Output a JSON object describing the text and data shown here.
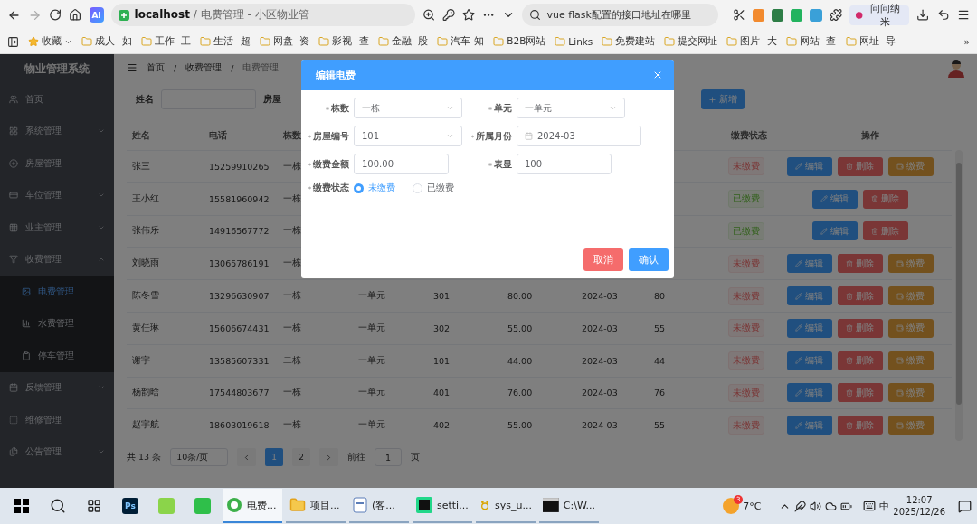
{
  "browser": {
    "ai_badge": "AI",
    "url_host": "localhost",
    "url_title": "/ 电费管理 - 小区物业管",
    "search": "vue flask配置的接口地址在哪里",
    "profile_button": "问问纳米",
    "bookmarks_label": "收藏",
    "bookmarks": [
      "成人--如",
      "工作--工",
      "生活--超",
      "网盘--资",
      "影视--查",
      "金融--股",
      "汽车-知",
      "B2B网站",
      "Links",
      "免费建站",
      "提交网址",
      "图片--大",
      "网站--查",
      "网址--导"
    ],
    "more": "»"
  },
  "sidebar": {
    "title": "物业管理系统",
    "items": [
      {
        "label": "首页",
        "kind": "link"
      },
      {
        "label": "系统管理",
        "kind": "group",
        "expanded": false
      },
      {
        "label": "房屋管理",
        "kind": "link"
      },
      {
        "label": "车位管理",
        "kind": "group",
        "expanded": false
      },
      {
        "label": "业主管理",
        "kind": "group",
        "expanded": false
      },
      {
        "label": "收费管理",
        "kind": "group",
        "expanded": true,
        "children": [
          {
            "label": "电费管理",
            "selected": true
          },
          {
            "label": "水费管理",
            "selected": false
          },
          {
            "label": "停车管理",
            "selected": false
          }
        ]
      },
      {
        "label": "反馈管理",
        "kind": "group",
        "expanded": false
      },
      {
        "label": "维修管理",
        "kind": "link"
      },
      {
        "label": "公告管理",
        "kind": "group",
        "expanded": false
      }
    ]
  },
  "header": {
    "breadcrumb": [
      "首页",
      "收费管理",
      "电费管理"
    ],
    "separator": "/"
  },
  "search": {
    "fields": [
      {
        "label": "姓名"
      },
      {
        "label": "房屋"
      }
    ],
    "add_button": "新增"
  },
  "table": {
    "columns": {
      "name": "姓名",
      "phone": "电话",
      "building": "栋数",
      "status": "缴费状态",
      "actions": "操作"
    },
    "rows": [
      {
        "name": "张三",
        "phone": "15259910265",
        "building": "一栋",
        "status": "未缴费",
        "paid": false,
        "actions": [
          {
            "kind": "edit",
            "label": "编辑"
          },
          {
            "kind": "delete",
            "label": "删除"
          },
          {
            "kind": "pay",
            "label": "缴费"
          }
        ]
      },
      {
        "name": "王小红",
        "phone": "15581960942",
        "building": "一栋",
        "status": "已缴费",
        "paid": true,
        "actions": [
          {
            "kind": "edit",
            "label": "编辑"
          },
          {
            "kind": "delete",
            "label": "删除"
          }
        ]
      },
      {
        "name": "张伟乐",
        "phone": "14916567772",
        "building": "一栋",
        "status": "已缴费",
        "paid": true,
        "actions": [
          {
            "kind": "edit",
            "label": "编辑"
          },
          {
            "kind": "delete",
            "label": "删除"
          }
        ]
      },
      {
        "name": "刘晓雨",
        "phone": "13065786191",
        "building": "一栋",
        "status": "未缴费",
        "paid": false,
        "actions": [
          {
            "kind": "edit",
            "label": "编辑"
          },
          {
            "kind": "delete",
            "label": "删除"
          },
          {
            "kind": "pay",
            "label": "缴费"
          }
        ]
      },
      {
        "name": "陈冬雪",
        "phone": "13296630907",
        "building": "一栋",
        "unit": "一单元",
        "room": "301",
        "amount": "80.00",
        "month": "2024-03",
        "reading": "80",
        "status": "未缴费",
        "paid": false,
        "actions": [
          {
            "kind": "edit",
            "label": "编辑"
          },
          {
            "kind": "delete",
            "label": "删除"
          },
          {
            "kind": "pay",
            "label": "缴费"
          }
        ]
      },
      {
        "name": "黄任琳",
        "phone": "15606674431",
        "building": "一栋",
        "unit": "一单元",
        "room": "302",
        "amount": "55.00",
        "month": "2024-03",
        "reading": "55",
        "status": "未缴费",
        "paid": false,
        "actions": [
          {
            "kind": "edit",
            "label": "编辑"
          },
          {
            "kind": "delete",
            "label": "删除"
          },
          {
            "kind": "pay",
            "label": "缴费"
          }
        ]
      },
      {
        "name": "谢宇",
        "phone": "13585607331",
        "building": "二栋",
        "unit": "一单元",
        "room": "101",
        "amount": "44.00",
        "month": "2024-03",
        "reading": "44",
        "status": "未缴费",
        "paid": false,
        "actions": [
          {
            "kind": "edit",
            "label": "编辑"
          },
          {
            "kind": "delete",
            "label": "删除"
          },
          {
            "kind": "pay",
            "label": "缴费"
          }
        ]
      },
      {
        "name": "杨韵晗",
        "phone": "17544803677",
        "building": "一栋",
        "unit": "一单元",
        "room": "401",
        "amount": "76.00",
        "month": "2024-03",
        "reading": "76",
        "status": "未缴费",
        "paid": false,
        "actions": [
          {
            "kind": "edit",
            "label": "编辑"
          },
          {
            "kind": "delete",
            "label": "删除"
          },
          {
            "kind": "pay",
            "label": "缴费"
          }
        ]
      },
      {
        "name": "赵宇航",
        "phone": "18603019618",
        "building": "一栋",
        "unit": "一单元",
        "room": "402",
        "amount": "55.00",
        "month": "2024-03",
        "reading": "55",
        "status": "未缴费",
        "paid": false,
        "actions": [
          {
            "kind": "edit",
            "label": "编辑"
          },
          {
            "kind": "delete",
            "label": "删除"
          },
          {
            "kind": "pay",
            "label": "缴费"
          }
        ]
      }
    ]
  },
  "pagination": {
    "total": "共 13 条",
    "page_size": "10条/页",
    "pages": [
      {
        "label": "1",
        "selected": true
      },
      {
        "label": "2",
        "selected": false
      }
    ],
    "goto_label": "前往",
    "goto_value": "1",
    "goto_unit": "页"
  },
  "modal": {
    "title": "编辑电费",
    "fields": [
      {
        "label": "栋数",
        "kind": "select",
        "value": "一栋",
        "required": true
      },
      {
        "label": "单元",
        "kind": "select",
        "value": "一单元",
        "required": true
      },
      {
        "label": "房屋编号",
        "kind": "select",
        "value": "101",
        "required": true
      },
      {
        "label": "所属月份",
        "kind": "date",
        "value": "2024-03",
        "required": true
      },
      {
        "label": "缴费金额",
        "kind": "input",
        "value": "100.00",
        "required": true
      },
      {
        "label": "表显",
        "kind": "input",
        "value": "100",
        "required": true
      }
    ],
    "status": {
      "label": "缴费状态",
      "required": true,
      "options": [
        {
          "label": "未缴费",
          "selected": true
        },
        {
          "label": "已缴费",
          "selected": false
        }
      ]
    },
    "buttons": [
      {
        "kind": "cancel",
        "label": "取消"
      },
      {
        "kind": "confirm",
        "label": "确认"
      }
    ]
  },
  "taskbar": {
    "pinned": [
      {
        "kind": "ps",
        "label": "Ps"
      },
      {
        "kind": "notes"
      },
      {
        "kind": "video"
      }
    ],
    "apps": [
      {
        "kind": "browser",
        "label": "电费...",
        "selected": true
      },
      {
        "kind": "folder",
        "label": "项目...",
        "selected": false
      },
      {
        "kind": "doc",
        "label": "(客...",
        "selected": false
      },
      {
        "kind": "ide",
        "label": "setti...",
        "selected": false
      },
      {
        "kind": "paw",
        "label": "sys_u...",
        "selected": false
      },
      {
        "kind": "terminal",
        "label": "C:\\W...",
        "selected": false
      }
    ],
    "weather": {
      "badge": "3",
      "temp": "7°C"
    },
    "ime": "中",
    "time": "12:07",
    "date": "2025/12/26"
  }
}
